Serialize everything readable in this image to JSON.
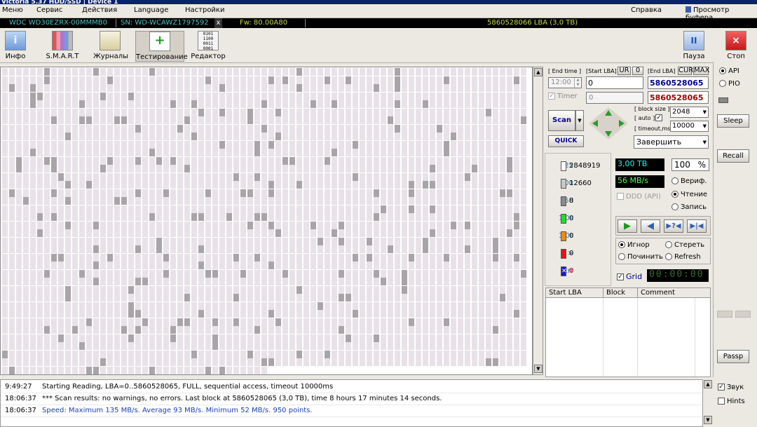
{
  "window": {
    "title": "Victoria 5.37 HDD/SSD | Device 1"
  },
  "menu": {
    "items": [
      "Меню",
      "Сервис",
      "Действия",
      "Language",
      "Настройки"
    ],
    "help": "Справка",
    "buffer": "Просмотр буфера"
  },
  "infobar": {
    "model": "WDC WD30EZRX-00MMMB0",
    "serial": "SN: WD-WCAWZ1797592",
    "close": "x",
    "firmware": "Fw: 80.00A80",
    "lba": "5860528066 LBA (3,0 TB)"
  },
  "toolbar": {
    "info": "Инфо",
    "smart": "S.M.A.R.T",
    "logs": "Журналы",
    "test": "Тестирование",
    "editor": "Редактор",
    "pause": "Пауза",
    "stop": "Стоп"
  },
  "controls": {
    "end_time_label": "[ End time ]",
    "end_time_value": "12:00",
    "timer_label": "Timer",
    "timer_value": "0",
    "start_lba_label": "[Start LBA]",
    "ur_label": "UR",
    "zero_label": "0",
    "start_lba_value": "0",
    "end_lba_label": "[End LBA]",
    "cur_label": "CUR",
    "max_label": "MAX",
    "end_lba_value": "5860528065",
    "end_lba_value2": "5860528065",
    "scan_label": "Scan",
    "quick_label": "QUICK",
    "block_size_label": "[ block size ]",
    "auto_label": "[ auto ]",
    "timeout_label": "[ timeout,ms ]",
    "block_size_value": "2048",
    "timeout_value": "10000",
    "finish_value": "Завершить",
    "size_display": "3,00 TB",
    "percent_display": "100",
    "percent_sign": "%",
    "speed_display": "56 MB/s",
    "ddd_label": "DDD (API)",
    "verify_label": "Вериф.",
    "read_label": "Чтение",
    "write_label": "Запись",
    "ignore_label": "Игнор",
    "erase_label": "Стереть",
    "repair_label": "Починить",
    "refresh_label": "Refresh",
    "grid_label": "Grid",
    "timer_display": "00:00:00"
  },
  "legend": [
    {
      "key": "25",
      "count": "2848919",
      "color": "#ffffff"
    },
    {
      "key": "100",
      "count": "12660",
      "color": "#c8c8c8"
    },
    {
      "key": "250",
      "count": "8",
      "color": "#8a8a8a"
    },
    {
      "key": "1,0s",
      "count": "0",
      "color": "#22dd22"
    },
    {
      "key": "3,0s",
      "count": "0",
      "color": "#ff8800"
    },
    {
      "key": ">",
      "count": "0",
      "color": "#ee1111"
    },
    {
      "key": "Err",
      "count": "0",
      "color": "#1a1acc"
    }
  ],
  "table": {
    "headers": [
      "Start LBA",
      "Block",
      "Comment"
    ]
  },
  "sidebar": {
    "api": "API",
    "pio": "PIO",
    "sleep": "Sleep",
    "recall": "Recall",
    "passp": "Passp",
    "sound": "Звук",
    "hints": "Hints"
  },
  "log": [
    {
      "time": "9:49:27",
      "msg": "Starting Reading, LBA=0..5860528065, FULL, sequential access, timeout 10000ms",
      "color": "#000000"
    },
    {
      "time": "18:06:37",
      "msg": "*** Scan results: no warnings, no errors. Last block at 5860528065 (3,0 TB), time 8 hours 17 minutes 14 seconds.",
      "color": "#000000"
    },
    {
      "time": "18:06:37",
      "msg": "Speed: Maximum 135 MB/s. Average 93 MB/s. Minimum 52 MB/s. 950 points.",
      "color": "#1a3fb0"
    }
  ]
}
